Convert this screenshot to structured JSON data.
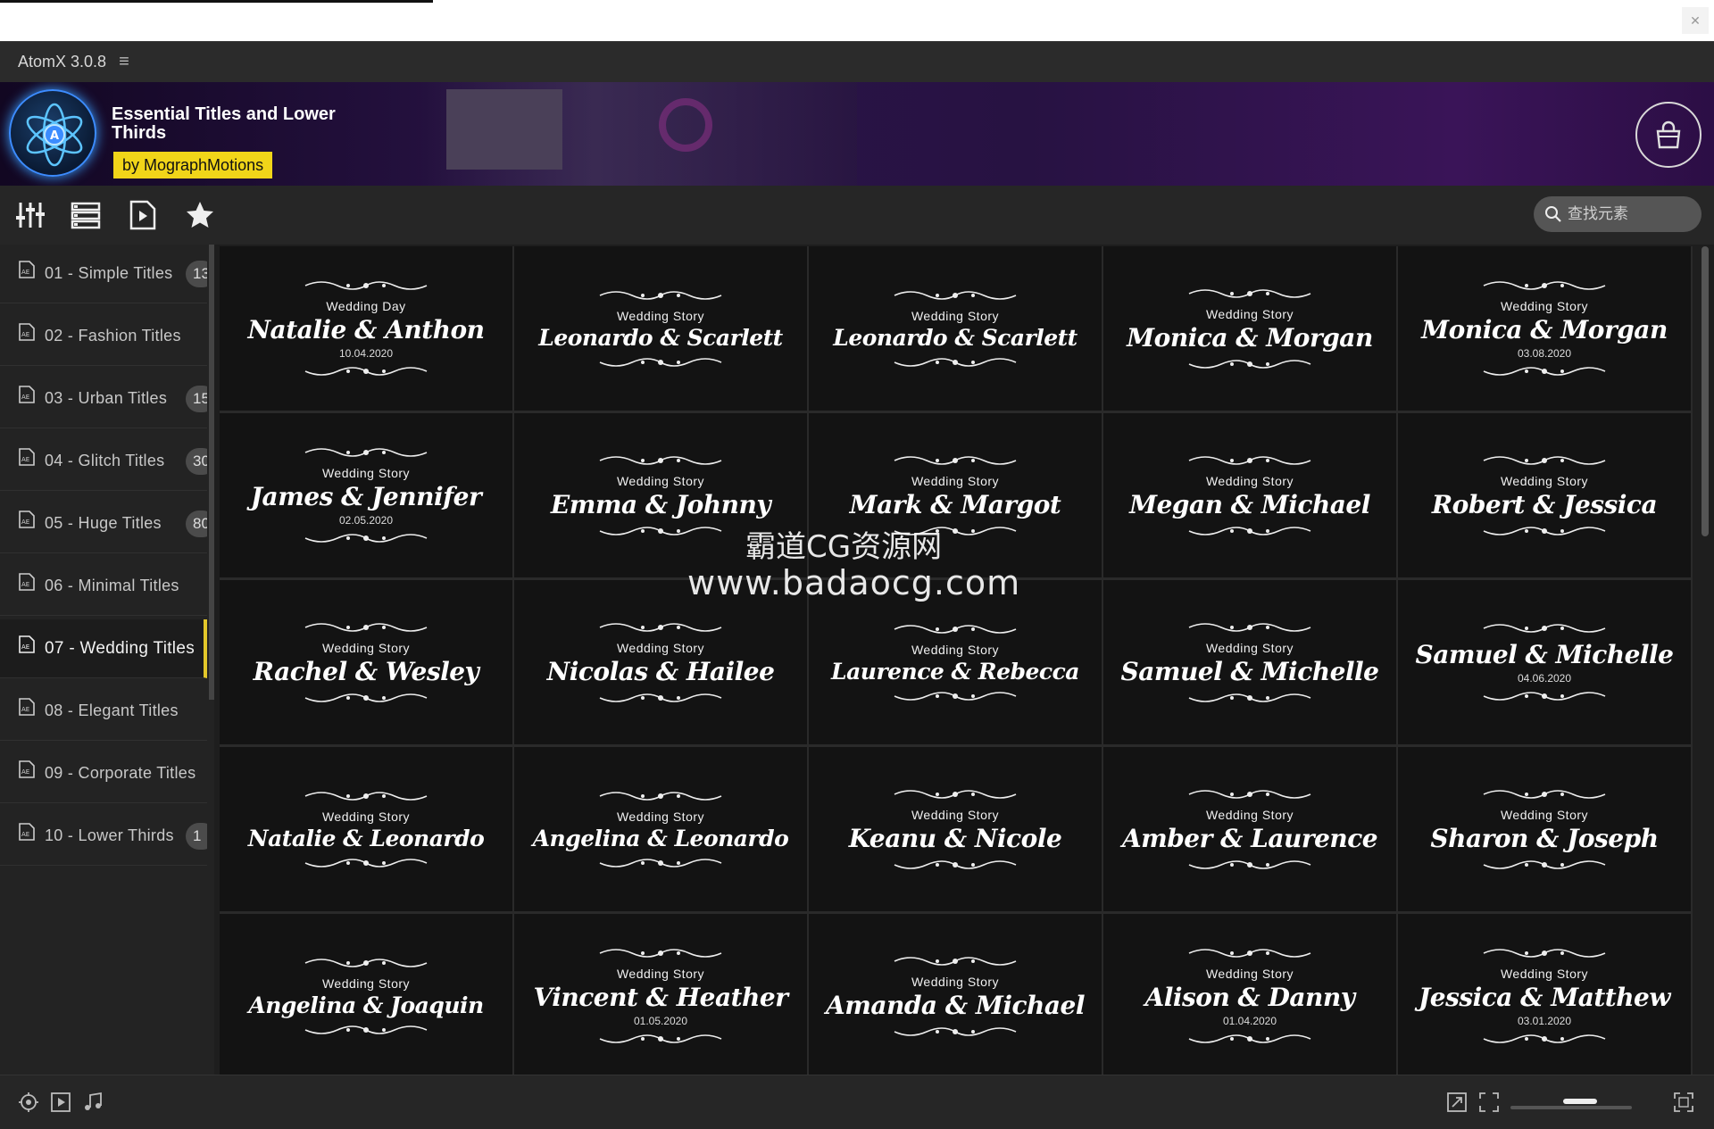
{
  "app": {
    "name": "AtomX 3.0.8",
    "menu_icon": "hamburger-icon"
  },
  "banner": {
    "title": "Essential Titles and Lower Thirds",
    "author_prefix": "by",
    "author": "MographMotions",
    "cart_icon": "shopping-bag-icon"
  },
  "toolbar": {
    "tools": [
      "sliders-icon",
      "list-view-icon",
      "play-file-icon",
      "star-icon"
    ],
    "search_placeholder": "查找元素"
  },
  "sidebar": {
    "items": [
      {
        "label": "01 - Simple Titles",
        "count": "13"
      },
      {
        "label": "02 - Fashion Titles",
        "count": ""
      },
      {
        "label": "03 - Urban Titles",
        "count": "15"
      },
      {
        "label": "04 - Glitch Titles",
        "count": "30"
      },
      {
        "label": "05 - Huge Titles",
        "count": "80"
      },
      {
        "label": "06 - Minimal Titles",
        "count": ""
      },
      {
        "label": "07 - Wedding Titles",
        "count": "",
        "active": true
      },
      {
        "label": "08 - Elegant Titles",
        "count": ""
      },
      {
        "label": "09 - Corporate Titles",
        "count": ""
      },
      {
        "label": "10 - Lower Thirds",
        "count": "1"
      }
    ]
  },
  "tiles": [
    {
      "top": "Wedding Day",
      "names": "Natalie & Anthon",
      "date": "10.04.2020"
    },
    {
      "top": "Wedding Story",
      "names": "Leonardo & Scarlett",
      "date": ""
    },
    {
      "top": "Wedding Story",
      "names": "Leonardo & Scarlett",
      "date": ""
    },
    {
      "top": "Wedding Story",
      "names": "Monica & Morgan",
      "date": ""
    },
    {
      "top": "Wedding Story",
      "names": "Monica & Morgan",
      "date": "03.08.2020"
    },
    {
      "top": "Wedding Story",
      "names": "James & Jennifer",
      "date": "02.05.2020"
    },
    {
      "top": "Wedding Story",
      "names": "Emma & Johnny",
      "date": ""
    },
    {
      "top": "Wedding Story",
      "names": "Mark & Margot",
      "date": ""
    },
    {
      "top": "Wedding Story",
      "names": "Megan & Michael",
      "date": ""
    },
    {
      "top": "Wedding Story",
      "names": "Robert & Jessica",
      "date": ""
    },
    {
      "top": "Wedding Story",
      "names": "Rachel & Wesley",
      "date": ""
    },
    {
      "top": "Wedding Story",
      "names": "Nicolas & Hailee",
      "date": ""
    },
    {
      "top": "Wedding Story",
      "names": "Laurence & Rebecca",
      "date": ""
    },
    {
      "top": "Wedding Story",
      "names": "Samuel & Michelle",
      "date": ""
    },
    {
      "top": "",
      "names": "Samuel & Michelle",
      "date": "04.06.2020"
    },
    {
      "top": "Wedding Story",
      "names": "Natalie & Leonardo",
      "date": ""
    },
    {
      "top": "Wedding Story",
      "names": "Angelina & Leonardo",
      "date": ""
    },
    {
      "top": "Wedding Story",
      "names": "Keanu & Nicole",
      "date": ""
    },
    {
      "top": "Wedding Story",
      "names": "Amber & Laurence",
      "date": ""
    },
    {
      "top": "Wedding Story",
      "names": "Sharon & Joseph",
      "date": ""
    },
    {
      "top": "Wedding Story",
      "names": "Angelina & Joaquin",
      "date": ""
    },
    {
      "top": "Wedding Story",
      "names": "Vincent & Heather",
      "date": "01.05.2020"
    },
    {
      "top": "Wedding Story",
      "names": "Amanda & Michael",
      "date": ""
    },
    {
      "top": "Wedding Story",
      "names": "Alison & Danny",
      "date": "01.04.2020"
    },
    {
      "top": "Wedding Story",
      "names": "Jessica & Matthew",
      "date": "03.01.2020"
    }
  ],
  "watermark": {
    "line1": "霸道CG资源网",
    "line2": "www.badaocg.com"
  },
  "bottom": {
    "left_icons": [
      "target-icon",
      "play-box-icon",
      "music-note-icon"
    ],
    "right_icons": [
      "resize-icon",
      "fullscreen-icon",
      "expand-icon"
    ],
    "zoom_level": 0.6
  }
}
